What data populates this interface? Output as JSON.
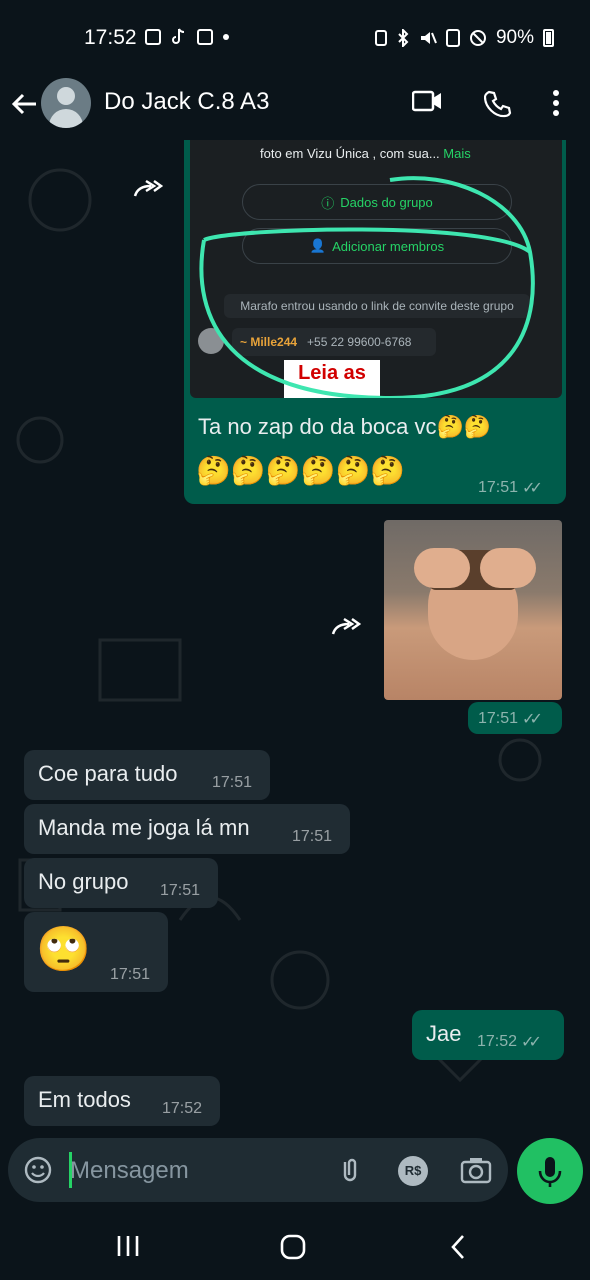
{
  "status_bar": {
    "time": "17:52",
    "battery": "90%",
    "icons": [
      "gallery-icon",
      "tiktok-icon",
      "cast-icon",
      "dot-icon",
      "sim-icon",
      "bluetooth-icon",
      "mute-icon",
      "nfc-icon",
      "dnd-icon",
      "battery-icon"
    ]
  },
  "header": {
    "contact_name": "Do Jack C.8 A3",
    "icons": [
      "back-arrow-icon",
      "video-call-icon",
      "phone-call-icon",
      "more-options-icon"
    ]
  },
  "messages": {
    "m1": {
      "direction": "out",
      "screenshot": {
        "line1_text": "foto em Vizu Única , com sua...",
        "line1_more": "Mais",
        "btn_group_info": "Dados do grupo",
        "btn_add_members": "Adicionar membros",
        "system_msg": "Marafo entrou usando o link de convite deste grupo",
        "sender_name": "~ Mille244",
        "sender_phone": "+55 22 99600-6768",
        "sticker_text": "Leia as"
      },
      "text": "Ta no zap do da boca vc🤔🤔",
      "emoji_line": "🤔🤔🤔🤔🤔🤔",
      "time": "17:51"
    },
    "m2": {
      "direction": "out",
      "type": "image",
      "time": "17:51"
    },
    "m3": {
      "direction": "in",
      "text": "Coe para tudo",
      "time": "17:51"
    },
    "m4": {
      "direction": "in",
      "text": "Manda me joga lá mn",
      "time": "17:51"
    },
    "m5": {
      "direction": "in",
      "text": "No grupo",
      "time": "17:51"
    },
    "m6": {
      "direction": "in",
      "text": "🙄",
      "time": "17:51"
    },
    "m7": {
      "direction": "out",
      "text": "Jae",
      "time": "17:52"
    },
    "m8": {
      "direction": "in",
      "text": "Em todos",
      "time": "17:52"
    }
  },
  "input": {
    "placeholder": "Mensagem",
    "icons": [
      "emoji-icon",
      "attach-icon",
      "payment-icon",
      "camera-icon",
      "mic-icon"
    ],
    "payment_label": "R$"
  },
  "colors": {
    "background": "#0b141a",
    "bubble_out": "#005c4b",
    "bubble_in": "#202c33",
    "accent": "#25d366",
    "mic": "#21c063"
  }
}
